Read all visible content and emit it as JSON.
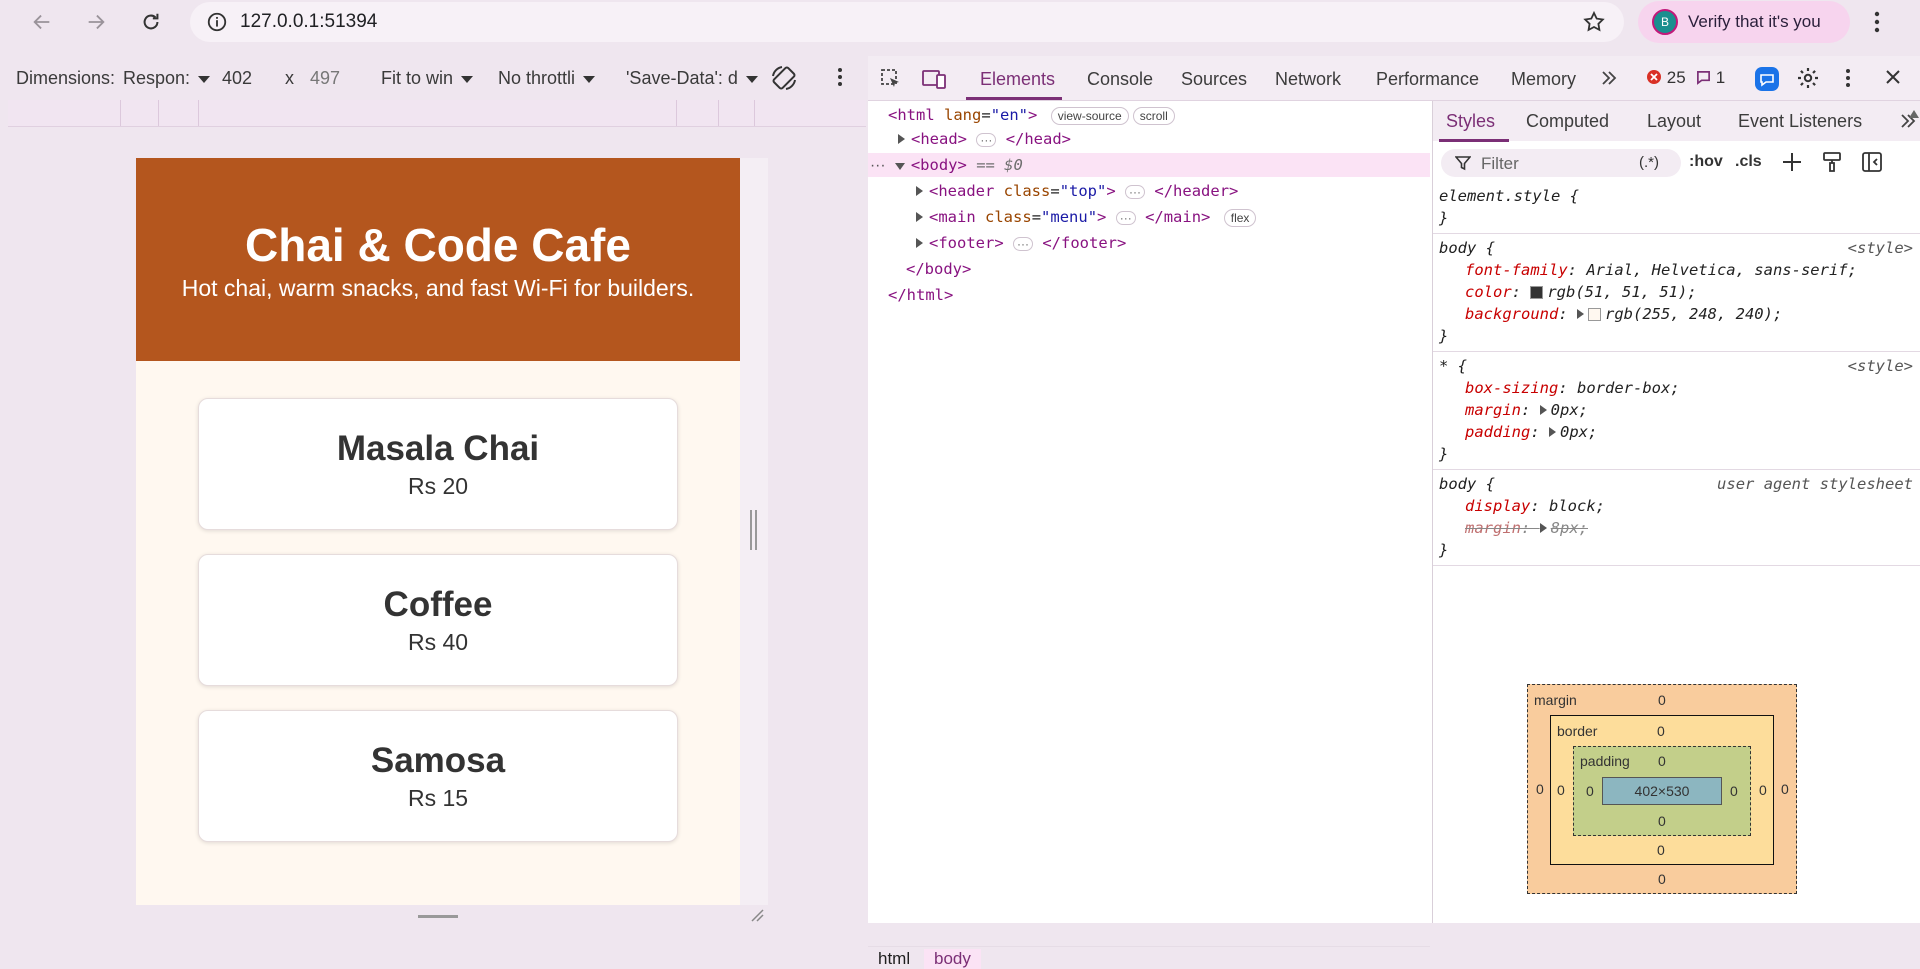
{
  "browser": {
    "url": "127.0.0.1:51394",
    "profile_initial": "B",
    "verify_label": "Verify that it's you"
  },
  "device_toolbar": {
    "dimensions_label": "Dimensions:",
    "device": "Respon:",
    "width": "402",
    "times": "x",
    "height": "497",
    "zoom": "Fit to win",
    "throttling": "No throttli",
    "save_data": "'Save-Data': d"
  },
  "page": {
    "title": "Chai & Code Cafe",
    "subtitle": "Hot chai, warm snacks, and fast Wi-Fi for builders.",
    "menu": [
      {
        "name": "Masala Chai",
        "price": "Rs 20"
      },
      {
        "name": "Coffee",
        "price": "Rs 40"
      },
      {
        "name": "Samosa",
        "price": "Rs 15"
      }
    ]
  },
  "devtools": {
    "tabs": [
      "Elements",
      "Console",
      "Sources",
      "Network",
      "Performance",
      "Memory"
    ],
    "active_tab": "Elements",
    "error_count": "25",
    "message_count": "1",
    "dom": {
      "html_open": "<html",
      "html_attr": "lang",
      "html_val": "\"en\"",
      "view_source": "view-source",
      "scroll": "scroll",
      "head": "<head>",
      "head_close": "</head>",
      "body": "<body>",
      "body_ref": "== $0",
      "header_open": "<header",
      "header_attr": "class",
      "header_val": "\"top\"",
      "header_close": "</header>",
      "main_open": "<main",
      "main_attr": "class",
      "main_val": "\"menu\"",
      "main_close": "</main>",
      "flex": "flex",
      "footer_open": "<footer>",
      "footer_close": "</footer>",
      "body_close": "</body>",
      "html_close": "</html>"
    },
    "breadcrumbs": [
      "html",
      "body"
    ],
    "styles_tabs": [
      "Styles",
      "Computed",
      "Layout",
      "Event Listeners"
    ],
    "filter_placeholder": "Filter",
    "filter_regex": "(.*)",
    "hov": ":hov",
    "cls": ".cls",
    "rules": {
      "element_style": "element.style {",
      "close": "}",
      "body_sel": "body {",
      "style_src": "<style>",
      "font_family_prop": "font-family",
      "font_family_val": "Arial, Helvetica, sans-serif;",
      "color_prop": "color",
      "color_val": "rgb(51, 51, 51);",
      "background_prop": "background",
      "background_val": "rgb(255, 248, 240);",
      "star_sel": "* {",
      "box_sizing_prop": "box-sizing",
      "box_sizing_val": "border-box;",
      "margin_prop": "margin",
      "margin_val": "0px;",
      "padding_prop": "padding",
      "padding_val": "0px;",
      "ua_src": "user agent stylesheet",
      "display_prop": "display",
      "display_val": "block;",
      "ua_margin_val": "8px;"
    },
    "box_model": {
      "margin_label": "margin",
      "border_label": "border",
      "padding_label": "padding",
      "content": "402×530",
      "zero": "0"
    },
    "colors": {
      "accent": "#7b2f76",
      "header_bg": "#b4561e",
      "page_bg": "#fff8f0",
      "swatch_color": "#333333"
    }
  }
}
